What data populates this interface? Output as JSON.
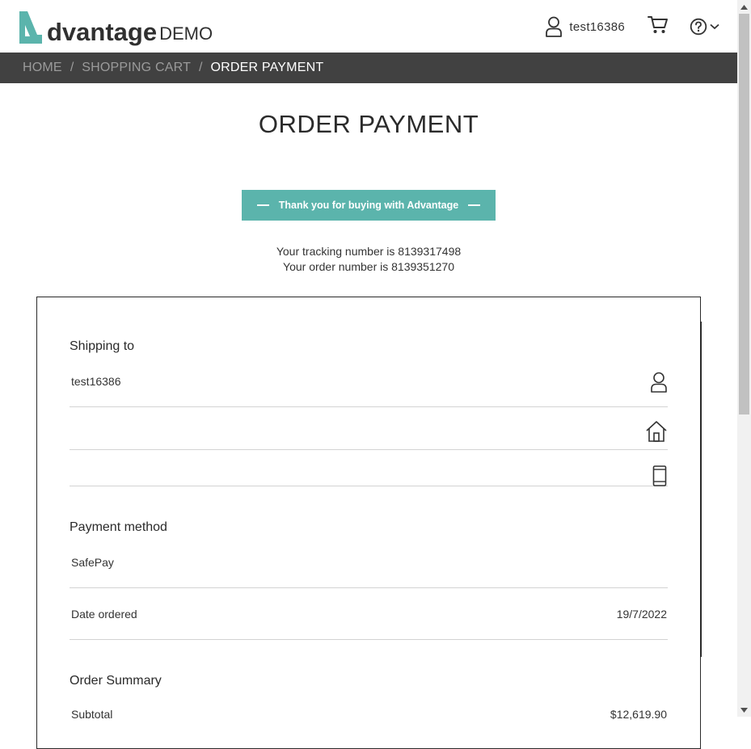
{
  "colors": {
    "brand_teal": "#5bb4ac",
    "breadcrumb_bg": "#414141",
    "breadcrumb_inactive": "#9b9b9b",
    "breadcrumb_active": "#ffffff"
  },
  "header": {
    "logo_word": "dvantage",
    "logo_suffix": "DEMO",
    "username": "test16386",
    "icons": [
      "user-icon",
      "cart-icon",
      "help-icon",
      "chevron-down-icon"
    ]
  },
  "breadcrumb": {
    "items": [
      "HOME",
      "SHOPPING CART",
      "ORDER PAYMENT"
    ],
    "separator": "/"
  },
  "page": {
    "title": "ORDER PAYMENT",
    "thanks_message": "Thank you for buying with Advantage",
    "tracking_line": "Your tracking number is 8139317498",
    "order_line": "Your order number is 8139351270"
  },
  "shipping": {
    "title": "Shipping to",
    "name": "test16386",
    "address": "",
    "phone": ""
  },
  "payment": {
    "title": "Payment method",
    "method": "SafePay",
    "date_label": "Date ordered",
    "date_value": "19/7/2022"
  },
  "summary": {
    "title": "Order Summary",
    "subtotal_label": "Subtotal",
    "subtotal_value": "$12,619.90"
  }
}
